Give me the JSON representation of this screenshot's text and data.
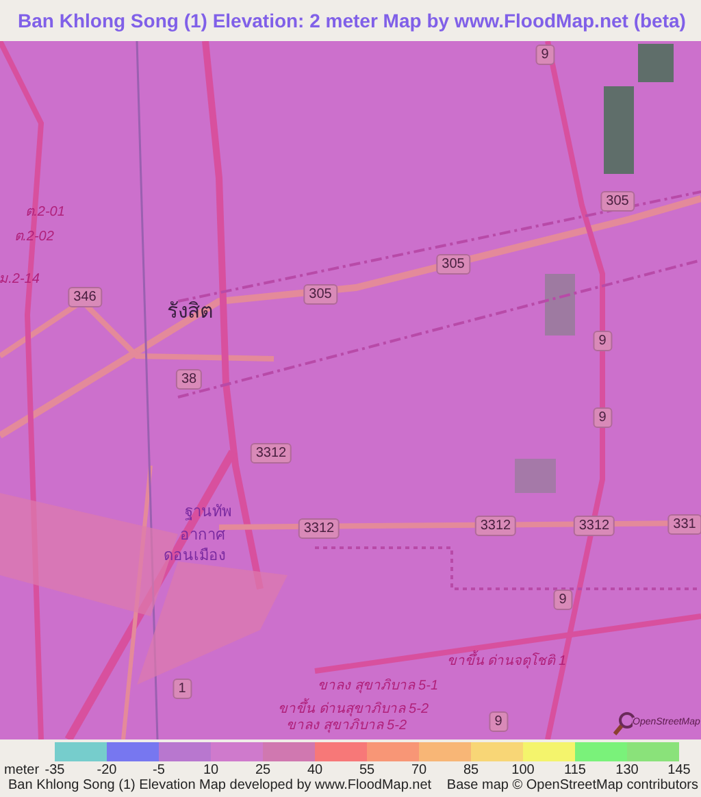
{
  "title": "Ban Khlong Song (1) Elevation: 2 meter Map by www.FloodMap.net (beta)",
  "map": {
    "labels": [
      {
        "text": "9",
        "kind": "shield"
      },
      {
        "text": "305",
        "kind": "shield"
      },
      {
        "text": "305",
        "kind": "shield"
      },
      {
        "text": "305",
        "kind": "shield"
      },
      {
        "text": "346",
        "kind": "shield"
      },
      {
        "text": "38",
        "kind": "shield"
      },
      {
        "text": "9",
        "kind": "shield"
      },
      {
        "text": "9",
        "kind": "shield"
      },
      {
        "text": "3312",
        "kind": "shield"
      },
      {
        "text": "3312",
        "kind": "shield"
      },
      {
        "text": "3312",
        "kind": "shield"
      },
      {
        "text": "3312",
        "kind": "shield"
      },
      {
        "text": "331",
        "kind": "shield"
      },
      {
        "text": "9",
        "kind": "shield"
      },
      {
        "text": "1",
        "kind": "shield"
      },
      {
        "text": "9",
        "kind": "shield"
      },
      {
        "text": "ต.2-01",
        "kind": "road"
      },
      {
        "text": "ต.2-02",
        "kind": "road"
      },
      {
        "text": "ม.2-14",
        "kind": "road"
      },
      {
        "text": "รังสิต",
        "kind": "place"
      },
      {
        "text": "ฐานทัพ",
        "kind": "poi"
      },
      {
        "text": "อากาศ",
        "kind": "poi"
      },
      {
        "text": "ดอนเมือง",
        "kind": "poi"
      },
      {
        "text": "ขาขึ้น ด่านจตุโชติ 1",
        "kind": "road"
      },
      {
        "text": "ขาลง สุขาภิบาล 5-1",
        "kind": "road"
      },
      {
        "text": "ขาขึ้น ด่านสุขาภิบาล 5-2",
        "kind": "road"
      },
      {
        "text": "ขาลง สุขาภิบาล 5-2",
        "kind": "road"
      }
    ],
    "attribution_logo": "OpenStreetMap"
  },
  "legend": {
    "unit": "meter",
    "items": [
      {
        "label": "-35",
        "color": "#76cdcc"
      },
      {
        "label": "-20",
        "color": "#7777f0"
      },
      {
        "label": "-5",
        "color": "#b877cf"
      },
      {
        "label": "10",
        "color": "#cf7acc"
      },
      {
        "label": "25",
        "color": "#d078b0"
      },
      {
        "label": "40",
        "color": "#f77878"
      },
      {
        "label": "55",
        "color": "#f89676"
      },
      {
        "label": "70",
        "color": "#f8b676"
      },
      {
        "label": "85",
        "color": "#f8d676"
      },
      {
        "label": "100",
        "color": "#f4f46c"
      },
      {
        "label": "115",
        "color": "#7af27a"
      },
      {
        "label": "130",
        "color": "#8ae27a"
      },
      {
        "label": "145"
      }
    ]
  },
  "footer": {
    "left": "Ban Khlong Song (1) Elevation Map developed by www.FloodMap.net",
    "right": "Base map © OpenStreetMap contributors"
  }
}
